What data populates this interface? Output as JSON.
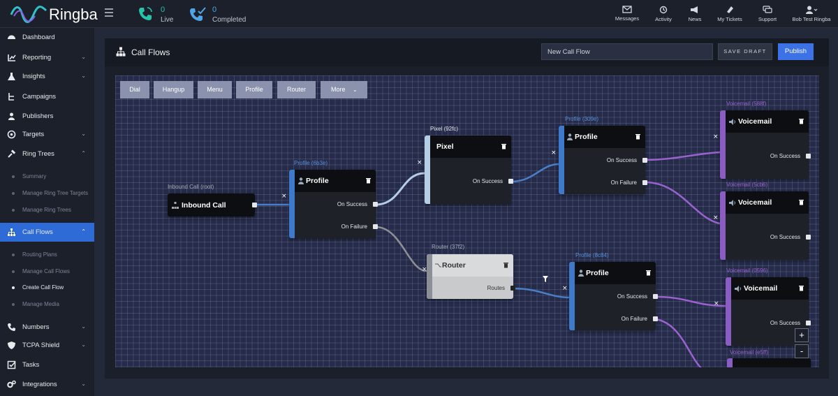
{
  "app": {
    "brand": "Ringba"
  },
  "topbar": {
    "live": {
      "count": "0",
      "label": "Live"
    },
    "completed": {
      "count": "0",
      "label": "Completed"
    },
    "icons": [
      {
        "label": "Messages",
        "icon": "envelope-icon"
      },
      {
        "label": "Activity",
        "icon": "history-icon"
      },
      {
        "label": "News",
        "icon": "megaphone-icon"
      },
      {
        "label": "My Tickets",
        "icon": "ticket-icon"
      },
      {
        "label": "Support",
        "icon": "chat-icon"
      },
      {
        "label": "Bob Test Ringba",
        "icon": "user-icon"
      }
    ]
  },
  "sidebar": {
    "items": [
      {
        "label": "Dashboard"
      },
      {
        "label": "Reporting"
      },
      {
        "label": "Insights"
      },
      {
        "label": "Campaigns"
      },
      {
        "label": "Publishers"
      },
      {
        "label": "Targets"
      },
      {
        "label": "Ring Trees"
      },
      {
        "label": "Call Flows"
      },
      {
        "label": "Numbers"
      },
      {
        "label": "TCPA Shield"
      },
      {
        "label": "Tasks"
      },
      {
        "label": "Integrations"
      }
    ],
    "ring_tree_sub": [
      "Summary",
      "Manage Ring Tree Targets",
      "Manage Ring Trees"
    ],
    "call_flow_sub": [
      "Routing Plans",
      "Manage Call Flows",
      "Create Call Flow",
      "Manage Media"
    ]
  },
  "page": {
    "title": "Call Flows",
    "flow_name": "New Call Flow",
    "save_draft": "SAVE DRAFT",
    "publish": "Publish"
  },
  "toolbar": [
    "Dial",
    "Hangup",
    "Menu",
    "Profile",
    "Router",
    "More"
  ],
  "nodes": {
    "inbound": {
      "caption": "Inbound Call (root)",
      "title": "Inbound Call"
    },
    "profile1": {
      "caption": "Profile (6b3e)",
      "title": "Profile",
      "out1": "On Success",
      "out2": "On Failure"
    },
    "pixel": {
      "caption": "Pixel (92fc)",
      "title": "Pixel",
      "out1": "On Success"
    },
    "router": {
      "caption": "Router (37f2)",
      "title": "Router",
      "out1": "Routes"
    },
    "profile2": {
      "caption": "Profile (309e)",
      "title": "Profile",
      "out1": "On Success",
      "out2": "On Failure"
    },
    "profile3": {
      "caption": "Profile (8c84)",
      "title": "Profile",
      "out1": "On Success",
      "out2": "On Failure"
    },
    "vm1": {
      "caption": "Voicemail (588f)",
      "title": "Voicemail",
      "out1": "On Success"
    },
    "vm2": {
      "caption": "Voicemail (5cb6)",
      "title": "Voicemail",
      "out1": "On Success"
    },
    "vm3": {
      "caption": "Voicemail (0596)",
      "title": "Voicemail",
      "out1": "On Success"
    },
    "vm4": {
      "caption": "Voicemail (e5ff)"
    }
  },
  "zoom": {
    "in": "+",
    "out": "-"
  },
  "colors": {
    "accent": "#3c72e6",
    "profile_bar": "#3f79c9",
    "voicemail_bar": "#8a5cc4",
    "live": "#25c3a8",
    "completed": "#4fa5e6"
  }
}
